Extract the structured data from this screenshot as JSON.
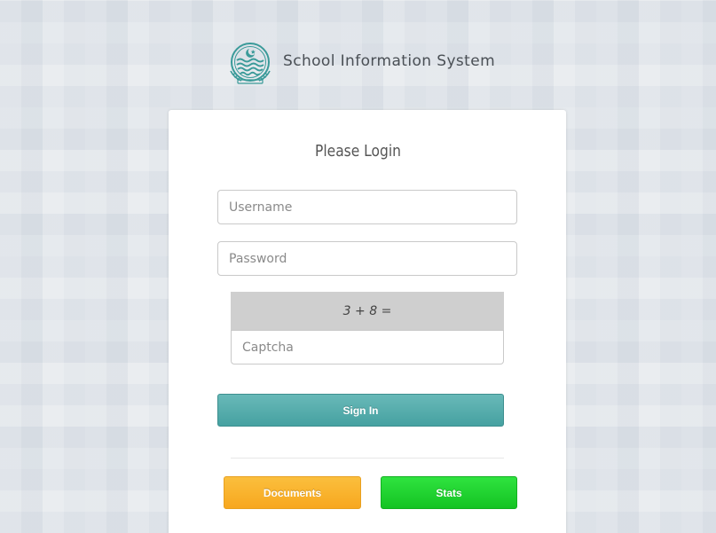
{
  "brand": {
    "title": "School Information System",
    "logo_icon": "punjab-emblem-icon",
    "accent_color": "#3a9a99"
  },
  "login": {
    "heading": "Please Login",
    "username_placeholder": "Username",
    "password_placeholder": "Password",
    "captcha_question": "3 + 8 =",
    "captcha_placeholder": "Captcha",
    "signin_label": "Sign In"
  },
  "footer_buttons": {
    "documents_label": "Documents",
    "stats_label": "Stats",
    "documents_color": "#f9b42e",
    "stats_color": "#1ed22f",
    "signin_color": "#55aeae"
  }
}
